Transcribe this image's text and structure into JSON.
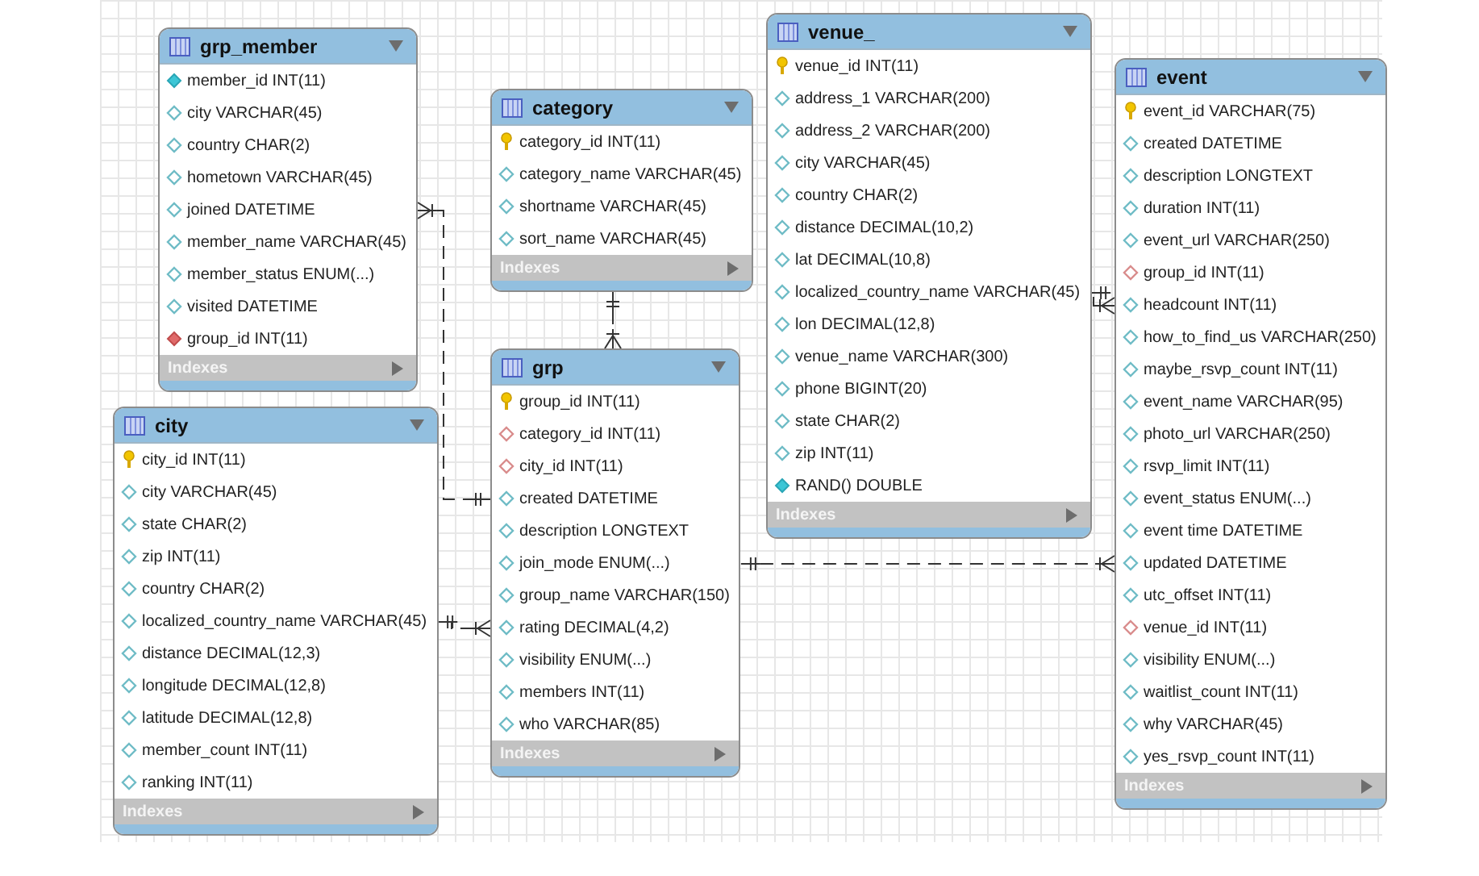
{
  "tables": [
    {
      "title": "grp_member",
      "footer": "Indexes",
      "columns": [
        {
          "text": "member_id INT(11)",
          "kind": "column_not_null"
        },
        {
          "text": "city VARCHAR(45)",
          "kind": "column"
        },
        {
          "text": "country CHAR(2)",
          "kind": "column"
        },
        {
          "text": "hometown VARCHAR(45)",
          "kind": "column"
        },
        {
          "text": "joined DATETIME",
          "kind": "column"
        },
        {
          "text": "member_name VARCHAR(45)",
          "kind": "column"
        },
        {
          "text": "member_status ENUM(...)",
          "kind": "column"
        },
        {
          "text": "visited DATETIME",
          "kind": "column"
        },
        {
          "text": "group_id INT(11)",
          "kind": "foreign_key_not_null"
        }
      ]
    },
    {
      "title": "city",
      "footer": "Indexes",
      "columns": [
        {
          "text": "city_id INT(11)",
          "kind": "primary_key"
        },
        {
          "text": "city VARCHAR(45)",
          "kind": "column"
        },
        {
          "text": "state CHAR(2)",
          "kind": "column"
        },
        {
          "text": "zip INT(11)",
          "kind": "column"
        },
        {
          "text": "country CHAR(2)",
          "kind": "column"
        },
        {
          "text": "localized_country_name VARCHAR(45)",
          "kind": "column"
        },
        {
          "text": "distance DECIMAL(12,3)",
          "kind": "column"
        },
        {
          "text": "longitude DECIMAL(12,8)",
          "kind": "column"
        },
        {
          "text": "latitude DECIMAL(12,8)",
          "kind": "column"
        },
        {
          "text": "member_count INT(11)",
          "kind": "column"
        },
        {
          "text": "ranking INT(11)",
          "kind": "column"
        }
      ]
    },
    {
      "title": "category",
      "footer": "Indexes",
      "columns": [
        {
          "text": "category_id INT(11)",
          "kind": "primary_key"
        },
        {
          "text": "category_name VARCHAR(45)",
          "kind": "column"
        },
        {
          "text": "shortname VARCHAR(45)",
          "kind": "column"
        },
        {
          "text": "sort_name VARCHAR(45)",
          "kind": "column"
        }
      ]
    },
    {
      "title": "grp",
      "footer": "Indexes",
      "columns": [
        {
          "text": "group_id INT(11)",
          "kind": "primary_key"
        },
        {
          "text": "category_id INT(11)",
          "kind": "foreign_key"
        },
        {
          "text": "city_id INT(11)",
          "kind": "foreign_key"
        },
        {
          "text": "created DATETIME",
          "kind": "column"
        },
        {
          "text": "description LONGTEXT",
          "kind": "column"
        },
        {
          "text": "join_mode ENUM(...)",
          "kind": "column"
        },
        {
          "text": "group_name VARCHAR(150)",
          "kind": "column"
        },
        {
          "text": "rating DECIMAL(4,2)",
          "kind": "column"
        },
        {
          "text": "visibility ENUM(...)",
          "kind": "column"
        },
        {
          "text": "members INT(11)",
          "kind": "column"
        },
        {
          "text": "who VARCHAR(85)",
          "kind": "column"
        }
      ]
    },
    {
      "title": "venue_",
      "footer": "Indexes",
      "columns": [
        {
          "text": "venue_id INT(11)",
          "kind": "primary_key"
        },
        {
          "text": "address_1 VARCHAR(200)",
          "kind": "column"
        },
        {
          "text": "address_2 VARCHAR(200)",
          "kind": "column"
        },
        {
          "text": "city VARCHAR(45)",
          "kind": "column"
        },
        {
          "text": "country CHAR(2)",
          "kind": "column"
        },
        {
          "text": "distance DECIMAL(10,2)",
          "kind": "column"
        },
        {
          "text": "lat DECIMAL(10,8)",
          "kind": "column"
        },
        {
          "text": "localized_country_name VARCHAR(45)",
          "kind": "column"
        },
        {
          "text": "lon DECIMAL(12,8)",
          "kind": "column"
        },
        {
          "text": "venue_name VARCHAR(300)",
          "kind": "column"
        },
        {
          "text": "phone BIGINT(20)",
          "kind": "column"
        },
        {
          "text": "state CHAR(2)",
          "kind": "column"
        },
        {
          "text": "zip INT(11)",
          "kind": "column"
        },
        {
          "text": "RAND() DOUBLE",
          "kind": "column_not_null"
        }
      ]
    },
    {
      "title": "event",
      "footer": "Indexes",
      "columns": [
        {
          "text": "event_id VARCHAR(75)",
          "kind": "primary_key"
        },
        {
          "text": "created DATETIME",
          "kind": "column"
        },
        {
          "text": "description LONGTEXT",
          "kind": "column"
        },
        {
          "text": "duration INT(11)",
          "kind": "column"
        },
        {
          "text": "event_url VARCHAR(250)",
          "kind": "column"
        },
        {
          "text": "group_id INT(11)",
          "kind": "foreign_key"
        },
        {
          "text": "headcount INT(11)",
          "kind": "column"
        },
        {
          "text": "how_to_find_us VARCHAR(250)",
          "kind": "column"
        },
        {
          "text": "maybe_rsvp_count INT(11)",
          "kind": "column"
        },
        {
          "text": "event_name VARCHAR(95)",
          "kind": "column"
        },
        {
          "text": "photo_url VARCHAR(250)",
          "kind": "column"
        },
        {
          "text": "rsvp_limit INT(11)",
          "kind": "column"
        },
        {
          "text": "event_status ENUM(...)",
          "kind": "column"
        },
        {
          "text": "event time DATETIME",
          "kind": "column"
        },
        {
          "text": "updated DATETIME",
          "kind": "column"
        },
        {
          "text": "utc_offset INT(11)",
          "kind": "column"
        },
        {
          "text": "venue_id INT(11)",
          "kind": "foreign_key"
        },
        {
          "text": "visibility ENUM(...)",
          "kind": "column"
        },
        {
          "text": "waitlist_count INT(11)",
          "kind": "column"
        },
        {
          "text": "why VARCHAR(45)",
          "kind": "column"
        },
        {
          "text": "yes_rsvp_count INT(11)",
          "kind": "column"
        }
      ]
    }
  ]
}
